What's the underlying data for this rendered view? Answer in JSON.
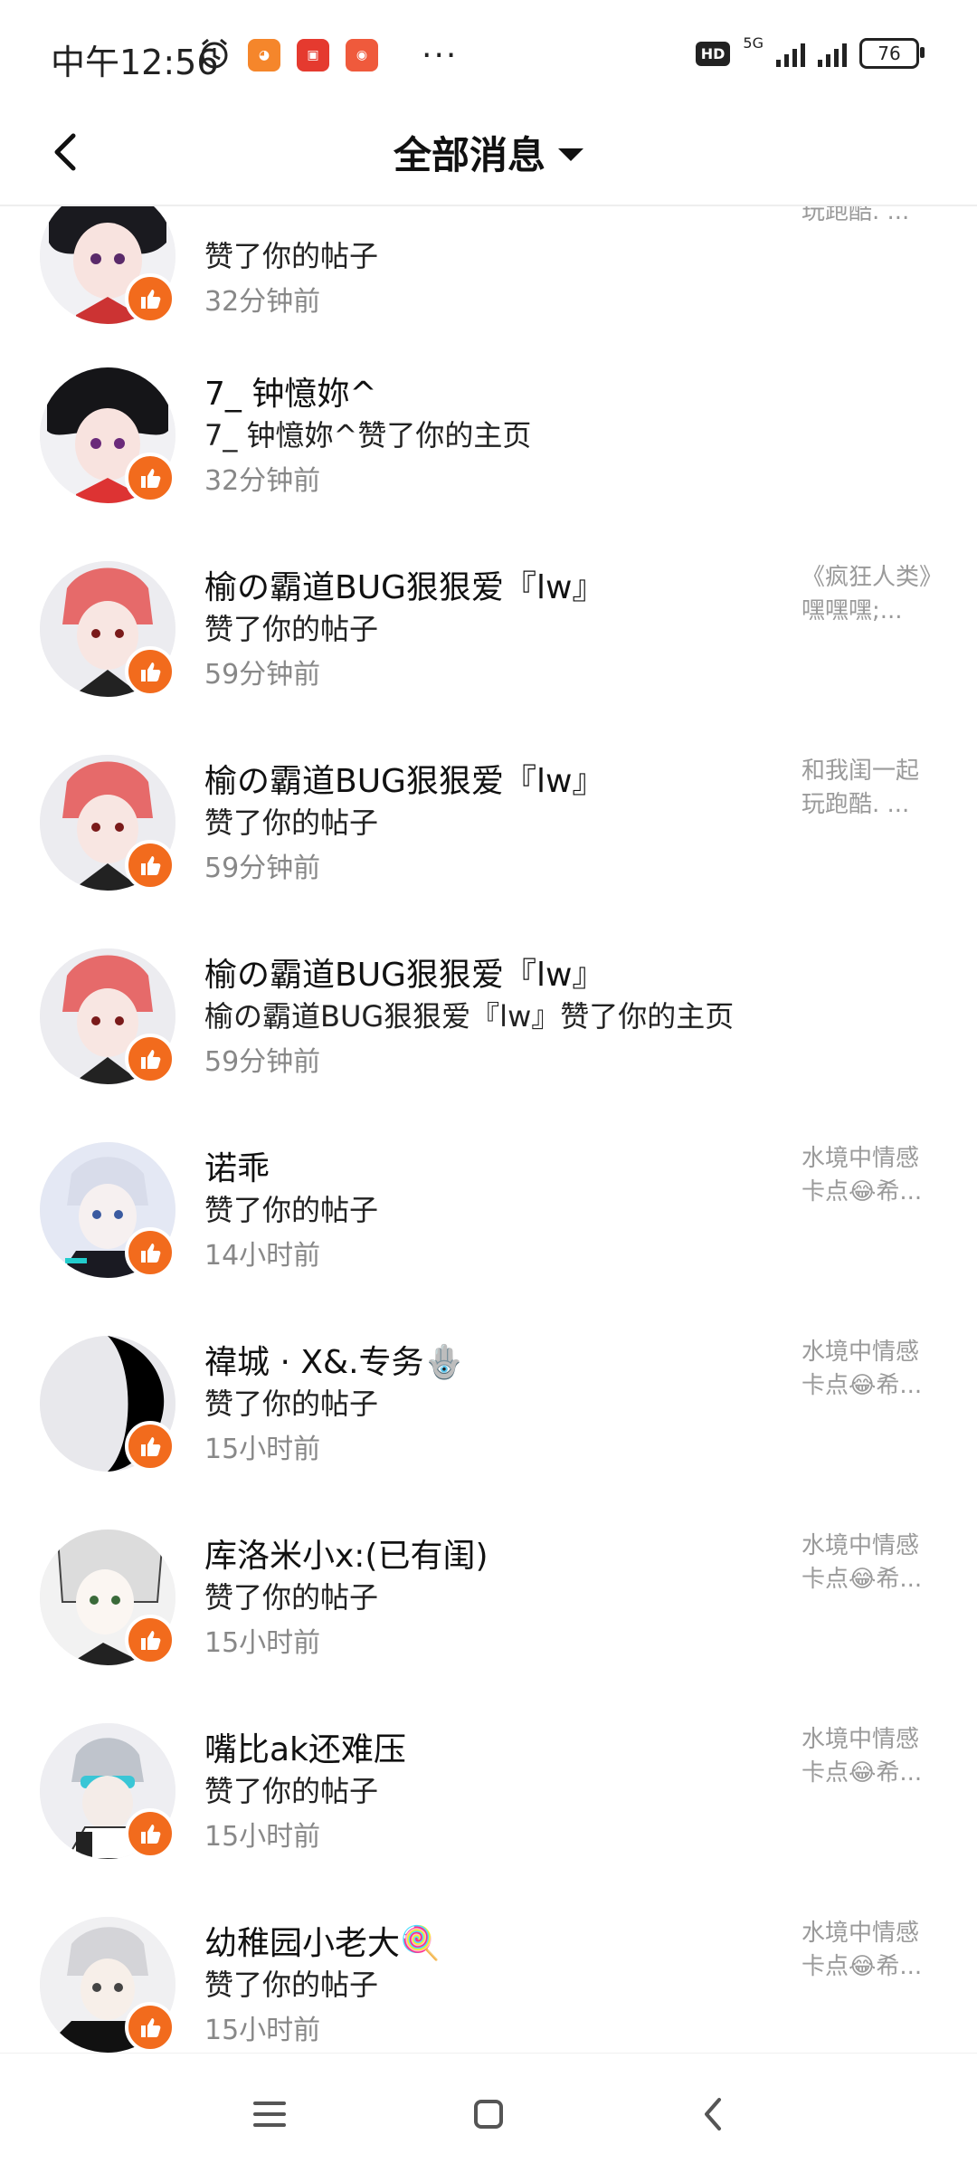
{
  "status_bar": {
    "time": "中午12:56",
    "network": "5G",
    "hd": "HD",
    "battery": "76",
    "more": "···"
  },
  "header": {
    "title": "全部消息"
  },
  "notifications": [
    {
      "name": "",
      "action": "赞了你的帖子",
      "time": "32分钟前",
      "preview": "玩跑酷. ..."
    },
    {
      "name": "7_ 钟憶妳^",
      "action": "7_ 钟憶妳^赞了你的主页",
      "time": "32分钟前",
      "preview": ""
    },
    {
      "name": "榆の霸道BUG狠狠爱『lw』",
      "action": "赞了你的帖子",
      "time": "59分钟前",
      "preview": "《疯狂人类》嘿嘿嘿;..."
    },
    {
      "name": "榆の霸道BUG狠狠爱『lw』",
      "action": "赞了你的帖子",
      "time": "59分钟前",
      "preview": "和我闺一起玩跑酷. ..."
    },
    {
      "name": "榆の霸道BUG狠狠爱『lw』",
      "action": "榆の霸道BUG狠狠爱『lw』赞了你的主页",
      "time": "59分钟前",
      "preview": ""
    },
    {
      "name": "诺乖",
      "action": "赞了你的帖子",
      "time": "14小时前",
      "preview": "水境中情感卡点😂希..."
    },
    {
      "name": "禕城 · X&.专务🪬",
      "action": "赞了你的帖子",
      "time": "15小时前",
      "preview": "水境中情感卡点😂希..."
    },
    {
      "name": "库洛米小x:(已有闺)",
      "action": "赞了你的帖子",
      "time": "15小时前",
      "preview": "水境中情感卡点😂希..."
    },
    {
      "name": "嘴比ak还难压",
      "action": "赞了你的帖子",
      "time": "15小时前",
      "preview": "水境中情感卡点😂希..."
    },
    {
      "name": "幼稚园小老大🍭",
      "action": "赞了你的帖子",
      "time": "15小时前",
      "preview": "水境中情感卡点😂希..."
    }
  ],
  "colors": {
    "accent": "#f26b1d",
    "muted": "#888888"
  }
}
